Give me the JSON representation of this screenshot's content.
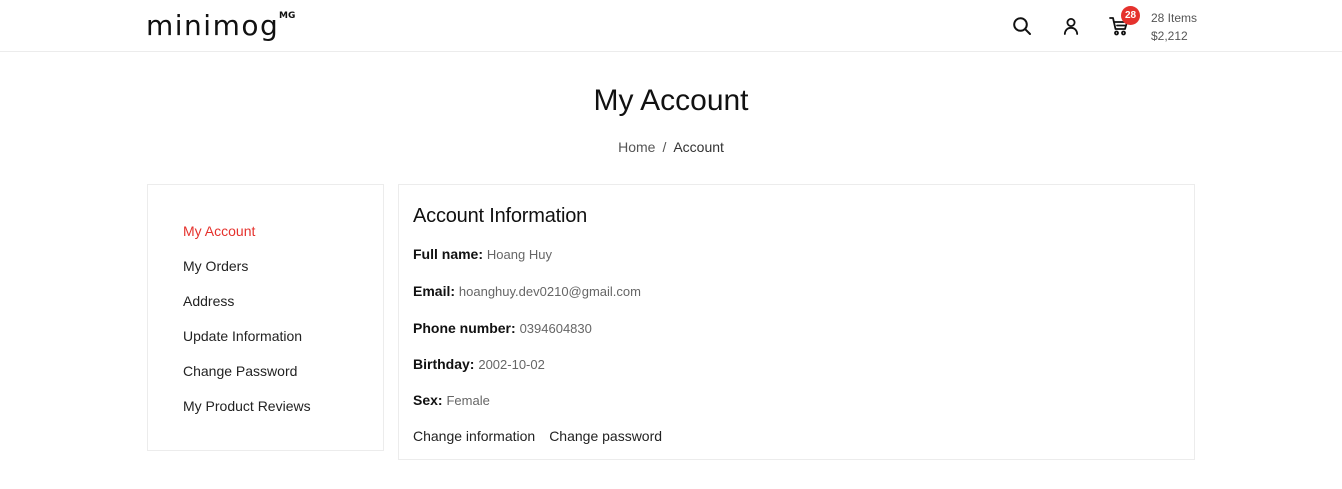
{
  "header": {
    "logo_text": "minimog",
    "logo_sup": "MG",
    "cart": {
      "badge": "28",
      "items_label": "28 Items",
      "total": "$2,212"
    },
    "icons": [
      "search-icon",
      "user-icon",
      "cart-icon"
    ]
  },
  "page": {
    "title": "My Account",
    "breadcrumb": {
      "home": "Home",
      "separator": "/",
      "current": "Account"
    }
  },
  "sidebar": {
    "items": [
      {
        "label": "My Account",
        "active": true
      },
      {
        "label": "My Orders",
        "active": false
      },
      {
        "label": "Address",
        "active": false
      },
      {
        "label": "Update Information",
        "active": false
      },
      {
        "label": "Change Password",
        "active": false
      },
      {
        "label": "My Product Reviews",
        "active": false
      }
    ]
  },
  "account": {
    "title": "Account Information",
    "fields": [
      {
        "label": "Full name:",
        "value": "Hoang Huy"
      },
      {
        "label": "Email:",
        "value": "hoanghuy.dev0210@gmail.com"
      },
      {
        "label": "Phone number:",
        "value": "0394604830"
      },
      {
        "label": "Birthday:",
        "value": "2002-10-02"
      },
      {
        "label": "Sex:",
        "value": "Female"
      }
    ],
    "actions": {
      "change_information": "Change information",
      "change_password": "Change password"
    }
  },
  "colors": {
    "accent": "#e5322d",
    "text": "#111111",
    "muted": "#666666",
    "border": "#ececec"
  }
}
